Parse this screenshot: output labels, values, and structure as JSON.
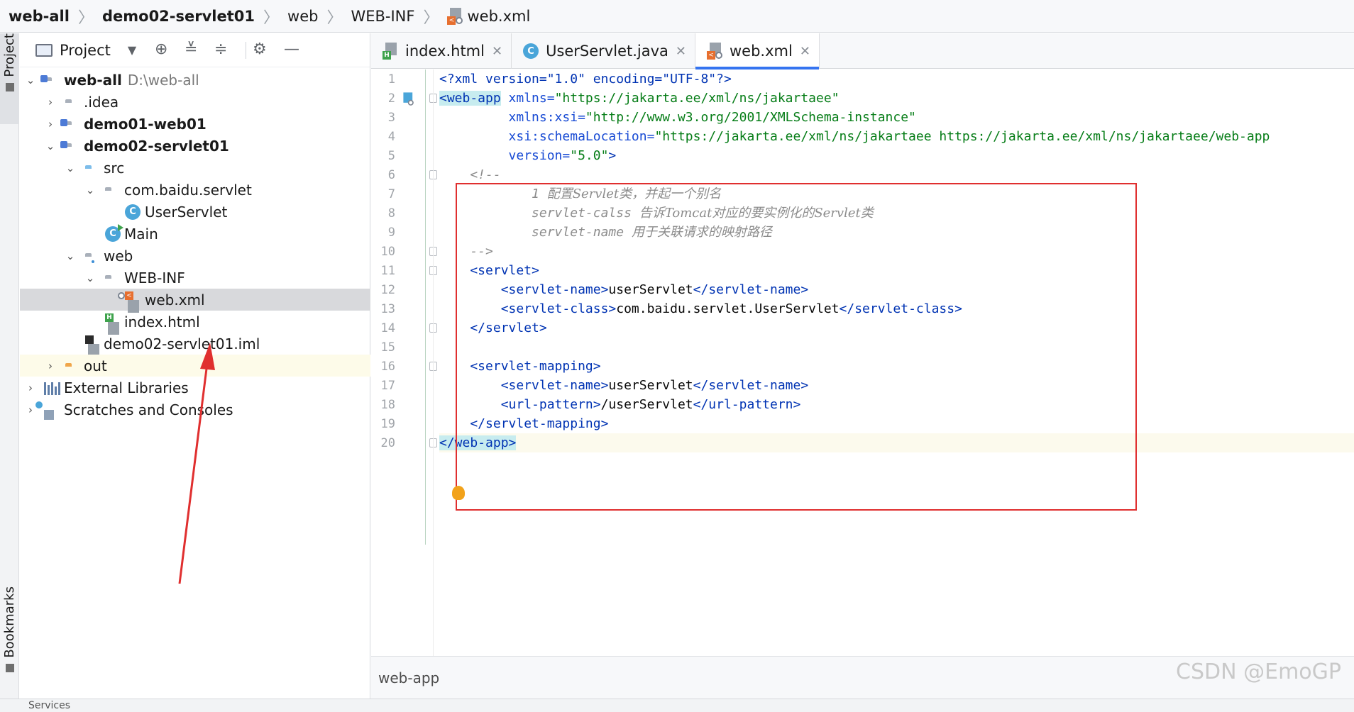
{
  "breadcrumb": [
    "web-all",
    "demo02-servlet01",
    "web",
    "WEB-INF",
    "web.xml"
  ],
  "stripe": {
    "project_label": "Project",
    "bookmarks_label": "Bookmarks"
  },
  "panel": {
    "title": "Project"
  },
  "tree": {
    "root_label": "web-all",
    "root_path": "D:\\web-all",
    "idea": ".idea",
    "demo01": "demo01-web01",
    "demo02": "demo02-servlet01",
    "src": "src",
    "package": "com.baidu.servlet",
    "user_servlet": "UserServlet",
    "main": "Main",
    "web": "web",
    "web_inf": "WEB-INF",
    "web_xml": "web.xml",
    "index_html": "index.html",
    "iml": "demo02-servlet01.iml",
    "out": "out",
    "external_libraries": "External Libraries",
    "scratches": "Scratches and Consoles"
  },
  "tabs": [
    {
      "label": "index.html",
      "icon": "html-file-icon"
    },
    {
      "label": "UserServlet.java",
      "icon": "java-class-icon"
    },
    {
      "label": "web.xml",
      "icon": "xml-file-icon"
    }
  ],
  "editor": {
    "lines": {
      "l1": {
        "p1": "<?xml version=\"1.0\" encoding=\"UTF-8\"?>"
      },
      "l2": {
        "tag": "<web-app",
        "attr": " xmlns=",
        "val": "\"https://jakarta.ee/xml/ns/jakartaee\""
      },
      "l3": {
        "attr": "         xmlns:xsi=",
        "val": "\"http://www.w3.org/2001/XMLSchema-instance\""
      },
      "l4": {
        "attr": "         xsi:schemaLocation=",
        "val": "\"https://jakarta.ee/xml/ns/jakartaee https://jakarta.ee/xml/ns/jakartaee/web-app"
      },
      "l5": {
        "attr": "         version=",
        "val": "\"5.0\"",
        "tag": ">"
      },
      "l6": {
        "cmt": "    <!--"
      },
      "l7": {
        "pre": "            1 ",
        "cmt": "配置Servlet类，并起一个别名"
      },
      "l8": {
        "pre": "            servlet-calss ",
        "cmt": "告诉Tomcat对应的要实例化的Servlet类"
      },
      "l9": {
        "pre": "            servlet-name ",
        "cmt": "用于关联请求的映射路径"
      },
      "l10": {
        "cmt": "    -->"
      },
      "l11": {
        "tag": "    <servlet>"
      },
      "l12": {
        "t1": "        <servlet-name>",
        "txt": "userServlet",
        "t2": "</servlet-name>"
      },
      "l13": {
        "t1": "        <servlet-class>",
        "txt": "com.baidu.servlet.UserServlet",
        "t2": "</servlet-class>"
      },
      "l14": {
        "tag": "    </servlet>"
      },
      "l15": {
        "tag": ""
      },
      "l16": {
        "tag": "    <servlet-mapping>"
      },
      "l17": {
        "t1": "        <servlet-name>",
        "txt": "userServlet",
        "t2": "</servlet-name>"
      },
      "l18": {
        "t1": "        <url-pattern>",
        "txt": "/userServlet",
        "t2": "</url-pattern>"
      },
      "l19": {
        "tag": "    </servlet-mapping>"
      },
      "l20": {
        "tag": "</web-app>"
      }
    },
    "line_numbers": [
      "1",
      "2",
      "3",
      "4",
      "5",
      "6",
      "7",
      "8",
      "9",
      "10",
      "11",
      "12",
      "13",
      "14",
      "15",
      "16",
      "17",
      "18",
      "19",
      "20"
    ]
  },
  "status": {
    "path": "web-app"
  },
  "watermark": "CSDN @EmoGP",
  "bottom": {
    "label": "Services"
  },
  "colors": {
    "accent": "#3574f0",
    "annotation": "#e02f2f"
  }
}
